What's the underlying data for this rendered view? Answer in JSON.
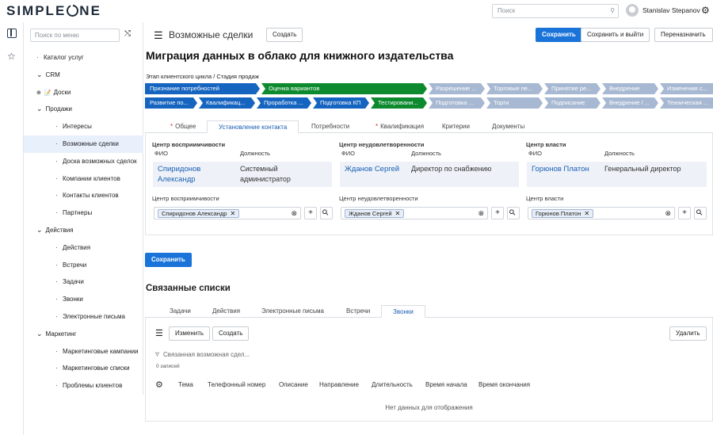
{
  "topbar": {
    "logo_left": "SIMPLE",
    "logo_right": "NE",
    "search_placeholder": "Поиск",
    "user": "Stanislav Stepanov"
  },
  "sidebar": {
    "search_placeholder": "Поиск по меню",
    "items": [
      {
        "label": "Каталог услуг",
        "kind": "leaf",
        "indent": 1
      },
      {
        "label": "CRM",
        "kind": "group",
        "indent": 1
      },
      {
        "label": "Доски",
        "kind": "plus",
        "indent": 2
      },
      {
        "label": "Продажи",
        "kind": "group",
        "indent": 2
      },
      {
        "label": "Интересы",
        "kind": "leaf",
        "indent": 3
      },
      {
        "label": "Возможные сделки",
        "kind": "leaf",
        "indent": 3,
        "selected": true
      },
      {
        "label": "Доска возможных сделок",
        "kind": "leaf",
        "indent": 3
      },
      {
        "label": "Компании клиентов",
        "kind": "leaf",
        "indent": 3
      },
      {
        "label": "Контакты клиентов",
        "kind": "leaf",
        "indent": 3
      },
      {
        "label": "Партнеры",
        "kind": "leaf",
        "indent": 3
      },
      {
        "label": "Действия",
        "kind": "group",
        "indent": 2
      },
      {
        "label": "Действия",
        "kind": "leaf",
        "indent": 3
      },
      {
        "label": "Встречи",
        "kind": "leaf",
        "indent": 3
      },
      {
        "label": "Задачи",
        "kind": "leaf",
        "indent": 3
      },
      {
        "label": "Звонки",
        "kind": "leaf",
        "indent": 3
      },
      {
        "label": "Электронные письма",
        "kind": "leaf",
        "indent": 3
      },
      {
        "label": "Маркетинг",
        "kind": "group",
        "indent": 2
      },
      {
        "label": "Маркетинговые кампании",
        "kind": "leaf",
        "indent": 3
      },
      {
        "label": "Маркетинговые списки",
        "kind": "leaf",
        "indent": 3
      },
      {
        "label": "Проблемы клиентов",
        "kind": "leaf",
        "indent": 3
      }
    ]
  },
  "header": {
    "title": "Возможные сделки",
    "create": "Создать",
    "save": "Сохранить",
    "save_exit": "Сохранить и выйти",
    "rename": "Переназначить"
  },
  "record": {
    "title": "Миграция данных в облако для книжного издательства",
    "stage_label": "Этап клиентского цикла / Стадия продаж"
  },
  "stages_row1": [
    {
      "label": "Признание потребностей",
      "state": "blue"
    },
    {
      "label": "Оценка вариантов",
      "state": "green"
    },
    {
      "label": "Разрешение ...",
      "state": "grey"
    },
    {
      "label": "Торговые пе...",
      "state": "grey"
    },
    {
      "label": "Принятие ре...",
      "state": "grey"
    },
    {
      "label": "Внедрение",
      "state": "grey"
    },
    {
      "label": "Изменения с...",
      "state": "grey"
    }
  ],
  "stages_row2": [
    {
      "label": "Развитие по...",
      "state": "blue"
    },
    {
      "label": "Квалификац...",
      "state": "blue"
    },
    {
      "label": "Проработка ...",
      "state": "blue"
    },
    {
      "label": "Подготовка КП",
      "state": "blue"
    },
    {
      "label": "Тестировани...",
      "state": "green"
    },
    {
      "label": "Подготовка ...",
      "state": "grey"
    },
    {
      "label": "Торги",
      "state": "grey"
    },
    {
      "label": "Подписание",
      "state": "grey"
    },
    {
      "label": "Внедрение / ...",
      "state": "grey"
    },
    {
      "label": "Техническая ...",
      "state": "grey"
    }
  ],
  "tabs": [
    {
      "label": "Общее",
      "required": true
    },
    {
      "label": "Установление контакта",
      "active": true
    },
    {
      "label": "Потребности"
    },
    {
      "label": "Квалификация",
      "required": true
    },
    {
      "label": "Критерии"
    },
    {
      "label": "Документы"
    }
  ],
  "groups": [
    {
      "title": "Центр восприимчивости",
      "col_name": "ФИО",
      "col_pos": "Должность",
      "name": "Спиридонов Александр",
      "position": "Системный администратор",
      "field_title": "Центр восприимчивости",
      "chip": "Спиридонов Александр"
    },
    {
      "title": "Центр неудовлетворенности",
      "col_name": "ФИО",
      "col_pos": "Должность",
      "name": "Жданов Сергей",
      "position": "Директор по снабжению",
      "field_title": "Центр неудовлетворенности",
      "chip": "Жданов Сергей"
    },
    {
      "title": "Центр власти",
      "col_name": "ФИО",
      "col_pos": "Должность",
      "name": "Горюнов Платон",
      "position": "Генеральный директор",
      "field_title": "Центр власти",
      "chip": "Горюнов Платон"
    }
  ],
  "save_button": "Сохранить",
  "related": {
    "title": "Связанные списки",
    "tabs": [
      "Задачи",
      "Действия",
      "Электронные письма",
      "Встречи",
      "Звонки"
    ],
    "active_tab": "Звонки",
    "edit": "Изменить",
    "create": "Создать",
    "delete": "Удалить",
    "filter": "Связанная возможная сдел...",
    "count": "0 записей",
    "columns": [
      "Тема",
      "Телефонный номер",
      "Описание",
      "Направление",
      "Длительность",
      "Время начала",
      "Время окончания"
    ],
    "empty": "Нет данных для отображения"
  }
}
